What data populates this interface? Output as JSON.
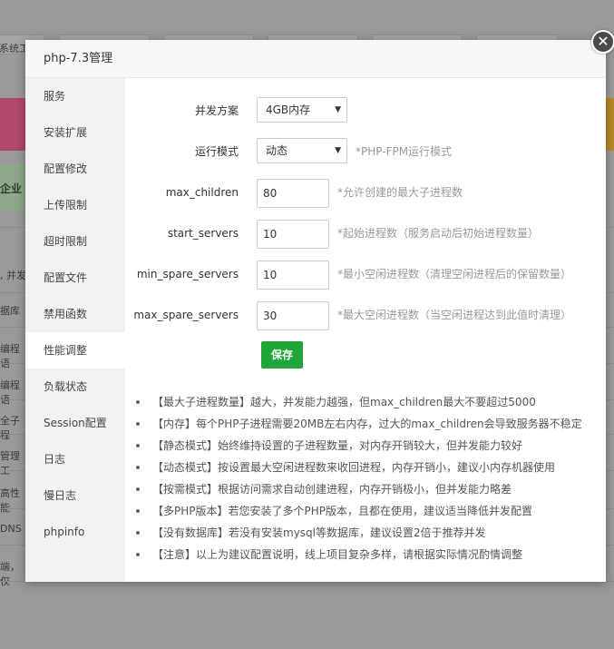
{
  "background": {
    "tab_label": "系统工",
    "green_text": "企业",
    "rows": [
      ", 并发",
      "据库",
      "编程语",
      "编程语",
      "全子程",
      "管理工",
      "高性能",
      "DNS",
      "端，仅"
    ]
  },
  "modal": {
    "title": "php-7.3管理",
    "close_glyph": "✕"
  },
  "sidebar": {
    "items": [
      {
        "label": "服务"
      },
      {
        "label": "安装扩展"
      },
      {
        "label": "配置修改"
      },
      {
        "label": "上传限制"
      },
      {
        "label": "超时限制"
      },
      {
        "label": "配置文件"
      },
      {
        "label": "禁用函数"
      },
      {
        "label": "性能调整",
        "active": true
      },
      {
        "label": "负载状态"
      },
      {
        "label": "Session配置"
      },
      {
        "label": "日志"
      },
      {
        "label": "慢日志"
      },
      {
        "label": "phpinfo"
      }
    ]
  },
  "form": {
    "concurrency": {
      "label": "并发方案",
      "value": "4GB内存"
    },
    "mode": {
      "label": "运行模式",
      "value": "动态",
      "hint": "*PHP-FPM运行模式"
    },
    "max_children": {
      "label": "max_children",
      "value": "80",
      "hint": "*允许创建的最大子进程数"
    },
    "start_servers": {
      "label": "start_servers",
      "value": "10",
      "hint": "*起始进程数（服务启动后初始进程数量）"
    },
    "min_spare_servers": {
      "label": "min_spare_servers",
      "value": "10",
      "hint": "*最小空闲进程数（清理空闲进程后的保留数量）"
    },
    "max_spare_servers": {
      "label": "max_spare_servers",
      "value": "30",
      "hint": "*最大空闲进程数（当空闲进程达到此值时清理）"
    },
    "save_label": "保存"
  },
  "notes": [
    "【最大子进程数量】越大，并发能力越强，但max_children最大不要超过5000",
    "【内存】每个PHP子进程需要20MB左右内存，过大的max_children会导致服务器不稳定",
    "【静态模式】始终维持设置的子进程数量，对内存开销较大，但并发能力较好",
    "【动态模式】按设置最大空闲进程数来收回进程，内存开销小，建议小内存机器使用",
    "【按需模式】根据访问需求自动创建进程，内存开销极小，但并发能力略差",
    "【多PHP版本】若您安装了多个PHP版本，且都在使用，建议适当降低并发配置",
    "【没有数据库】若没有安装mysql等数据库，建议设置2倍于推荐并发",
    "【注意】以上为建议配置说明，线上项目复杂多样，请根据实际情况酌情调整"
  ],
  "colors": {
    "accent_green": "#20a53a",
    "sidebar_bg": "#f2f2f2",
    "hint_gray": "#999999"
  }
}
